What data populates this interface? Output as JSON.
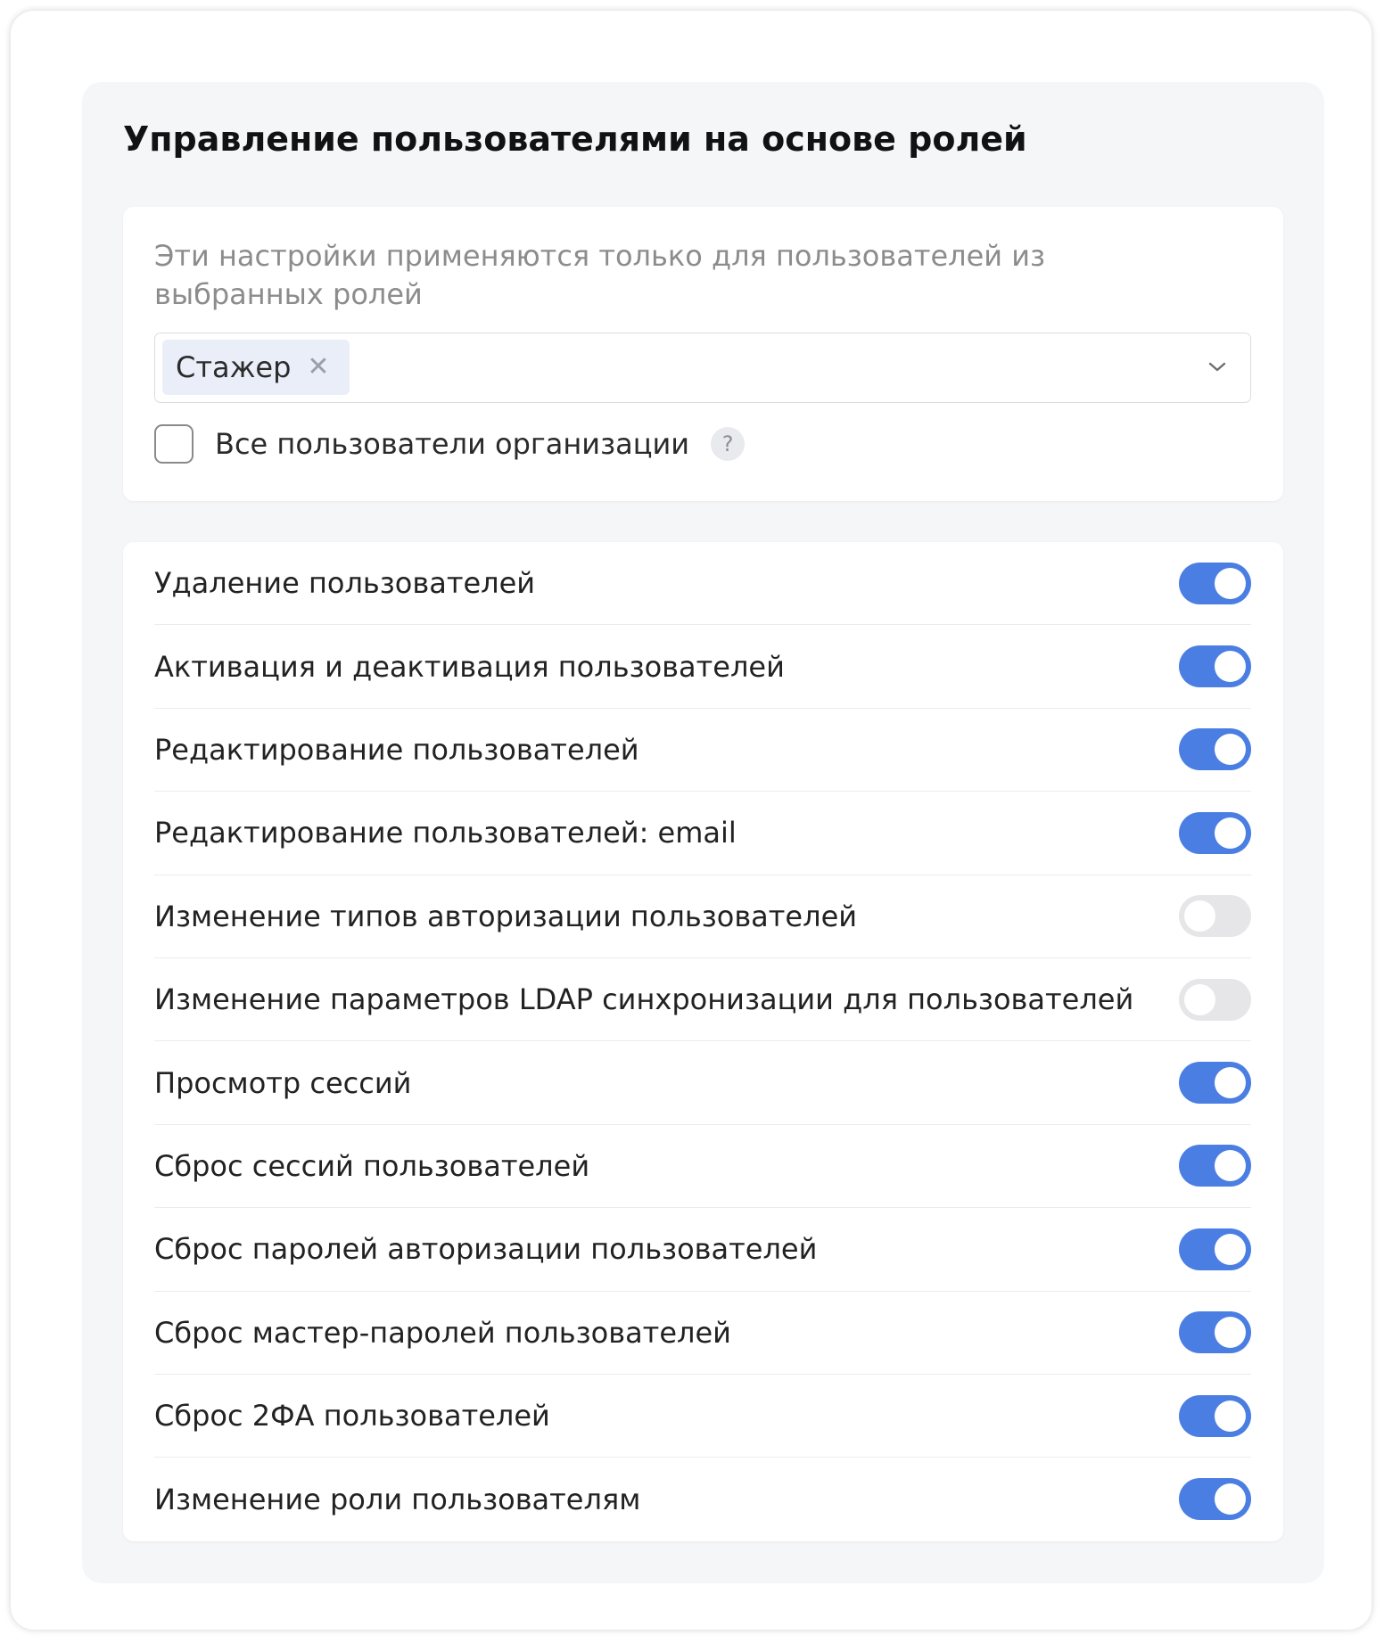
{
  "panel": {
    "title": "Управление пользователями на основе ролей"
  },
  "roles": {
    "description": "Эти настройки применяются только для пользователей из выбранных ролей",
    "selected_role": "Стажер",
    "chip_remove_glyph": "✕",
    "all_users_label": "Все пользователи организации",
    "all_users_checked": false,
    "help_glyph": "?"
  },
  "colors": {
    "toggle_on": "#4b7ee3",
    "toggle_off": "#e6e6e8",
    "panel_bg": "#f5f6f8"
  },
  "permissions": [
    {
      "label": "Удаление пользователей",
      "enabled": true
    },
    {
      "label": "Активация и деактивация пользователей",
      "enabled": true
    },
    {
      "label": "Редактирование пользователей",
      "enabled": true
    },
    {
      "label": "Редактирование пользователей: email",
      "enabled": true
    },
    {
      "label": "Изменение типов авторизации пользователей",
      "enabled": false
    },
    {
      "label": "Изменение параметров LDAP синхронизации для пользователей",
      "enabled": false
    },
    {
      "label": "Просмотр сессий",
      "enabled": true
    },
    {
      "label": "Сброс сессий пользователей",
      "enabled": true
    },
    {
      "label": "Сброс паролей авторизации пользователей",
      "enabled": true
    },
    {
      "label": "Сброс мастер-паролей пользователей",
      "enabled": true
    },
    {
      "label": "Сброс 2ФА пользователей",
      "enabled": true
    },
    {
      "label": "Изменение роли пользователям",
      "enabled": true
    }
  ]
}
